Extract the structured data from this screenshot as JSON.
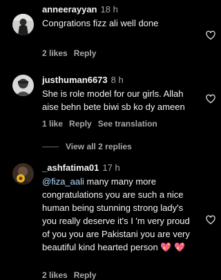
{
  "comments": [
    {
      "username": "anneerayyan",
      "time": "18 h",
      "text": "Congrations fizz ali well done",
      "likes": "2 likes",
      "reply": "Reply"
    },
    {
      "username": "justhuman6673",
      "time": "8 h",
      "text": "She is role model for our girls. Allah aise behn bete biwi sb ko dy ameen",
      "likes": "1 like",
      "reply": "Reply",
      "translation": "See translation"
    },
    {
      "username": "_ashfatima01",
      "time": "17 h",
      "mention": "@fiza_aali",
      "text": " many many more congratulations you are such a nice human being stunning strong lady's you really deserve it's I 'm very proud of you you are Pakistani you are very beautiful kind hearted person ",
      "emoji": "💖 💖",
      "likes": "2 likes",
      "reply": "Reply"
    }
  ],
  "view_replies": "View all 2 replies",
  "colors": {
    "background": "#000000",
    "secondary_text": "#a8a8a8",
    "mention": "#b3dbff"
  },
  "icons": [
    "heart-outline-icon"
  ]
}
